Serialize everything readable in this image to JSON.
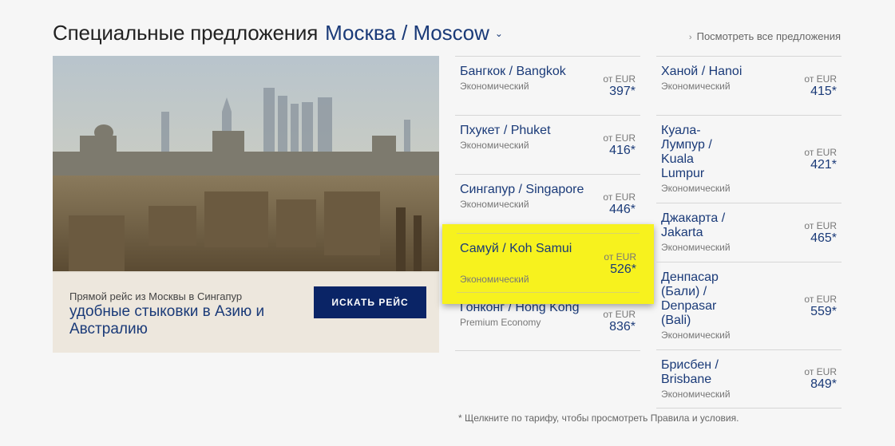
{
  "header": {
    "title": "Специальные предложения",
    "city": "Москва / Moscow",
    "view_all": "Посмотреть все предложения"
  },
  "promo": {
    "subtitle": "Прямой рейс из Москвы в Сингапур",
    "headline": "удобные стыковки в Азию и Австралию",
    "button": "ИСКАТЬ РЕЙС"
  },
  "deals_left": [
    {
      "dest": "Бангкок / Bangkok",
      "cls": "Экономический",
      "from": "от EUR",
      "price": "397*"
    },
    {
      "dest": "Пхукет / Phuket",
      "cls": "Экономический",
      "from": "от EUR",
      "price": "416*"
    },
    {
      "dest": "Сингапур / Singapore",
      "cls": "Экономический",
      "from": "от EUR",
      "price": "446*"
    },
    {
      "dest": "Самуй / Koh Samui",
      "cls": "Экономический",
      "from": "от EUR",
      "price": "526*"
    },
    {
      "dest": "Гонконг / Hong Kong",
      "cls": "Premium Economy",
      "from": "от EUR",
      "price": "836*"
    }
  ],
  "deals_right": [
    {
      "dest": "Ханой / Hanoi",
      "cls": "Экономический",
      "from": "от EUR",
      "price": "415*"
    },
    {
      "dest": "Куала-Лумпур / Kuala Lumpur",
      "cls": "Экономический",
      "from": "от EUR",
      "price": "421*"
    },
    {
      "dest": "Джакарта / Jakarta",
      "cls": "Экономический",
      "from": "от EUR",
      "price": "465*"
    },
    {
      "dest": "Денпасар (Бали) / Denpasar (Bali)",
      "cls": "Экономический",
      "from": "от EUR",
      "price": "559*"
    },
    {
      "dest": "Брисбен / Brisbane",
      "cls": "Экономический",
      "from": "от EUR",
      "price": "849*"
    }
  ],
  "footnote": "* Щелкните по тарифу, чтобы просмотреть Правила и условия.",
  "colors": {
    "accent": "#1a3a78",
    "button": "#0a2466",
    "highlight": "#f7f21e"
  }
}
